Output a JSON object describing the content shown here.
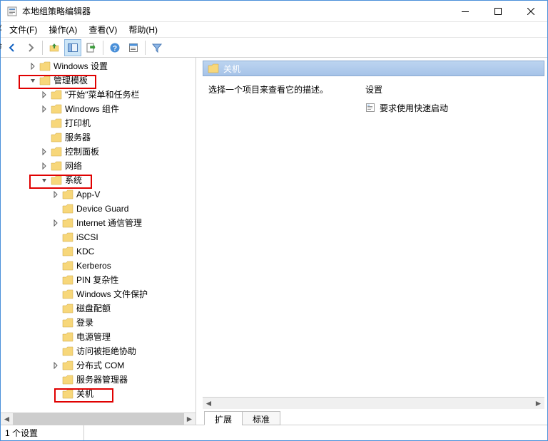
{
  "window": {
    "title": "本地组策略编辑器"
  },
  "menubar": {
    "file": "文件(F)",
    "action": "操作(A)",
    "view": "查看(V)",
    "help": "帮助(H)"
  },
  "left_overflow": {
    "a": "业",
    "b": "命"
  },
  "tree": {
    "items": [
      {
        "indent": 1,
        "arrow": "▶",
        "label": "Windows 设置"
      },
      {
        "indent": 1,
        "arrow": "▾",
        "label": "管理模板",
        "hilite": 1
      },
      {
        "indent": 2,
        "arrow": "▶",
        "label": "\"开始\"菜单和任务栏"
      },
      {
        "indent": 2,
        "arrow": "▶",
        "label": "Windows 组件"
      },
      {
        "indent": 2,
        "arrow": "",
        "label": "打印机"
      },
      {
        "indent": 2,
        "arrow": "",
        "label": "服务器"
      },
      {
        "indent": 2,
        "arrow": "▶",
        "label": "控制面板"
      },
      {
        "indent": 2,
        "arrow": "▶",
        "label": "网络"
      },
      {
        "indent": 2,
        "arrow": "▾",
        "label": "系统",
        "hilite": 2
      },
      {
        "indent": 3,
        "arrow": "▶",
        "label": "App-V"
      },
      {
        "indent": 3,
        "arrow": "",
        "label": "Device Guard"
      },
      {
        "indent": 3,
        "arrow": "▶",
        "label": "Internet 通信管理"
      },
      {
        "indent": 3,
        "arrow": "",
        "label": "iSCSI"
      },
      {
        "indent": 3,
        "arrow": "",
        "label": "KDC"
      },
      {
        "indent": 3,
        "arrow": "",
        "label": "Kerberos"
      },
      {
        "indent": 3,
        "arrow": "",
        "label": "PIN 复杂性"
      },
      {
        "indent": 3,
        "arrow": "",
        "label": "Windows 文件保护"
      },
      {
        "indent": 3,
        "arrow": "",
        "label": "磁盘配额"
      },
      {
        "indent": 3,
        "arrow": "",
        "label": "登录"
      },
      {
        "indent": 3,
        "arrow": "",
        "label": "电源管理"
      },
      {
        "indent": 3,
        "arrow": "",
        "label": "访问被拒绝协助"
      },
      {
        "indent": 3,
        "arrow": "▶",
        "label": "分布式 COM"
      },
      {
        "indent": 3,
        "arrow": "",
        "label": "服务器管理器"
      },
      {
        "indent": 3,
        "arrow": "",
        "label": "关机",
        "hilite": 3
      }
    ]
  },
  "details": {
    "header": "关机",
    "description": "选择一个项目来查看它的描述。",
    "settings_header": "设置",
    "items": [
      {
        "label": "要求使用快速启动"
      }
    ],
    "tabs": {
      "extended": "扩展",
      "standard": "标准"
    }
  },
  "statusbar": {
    "text": "1 个设置"
  }
}
